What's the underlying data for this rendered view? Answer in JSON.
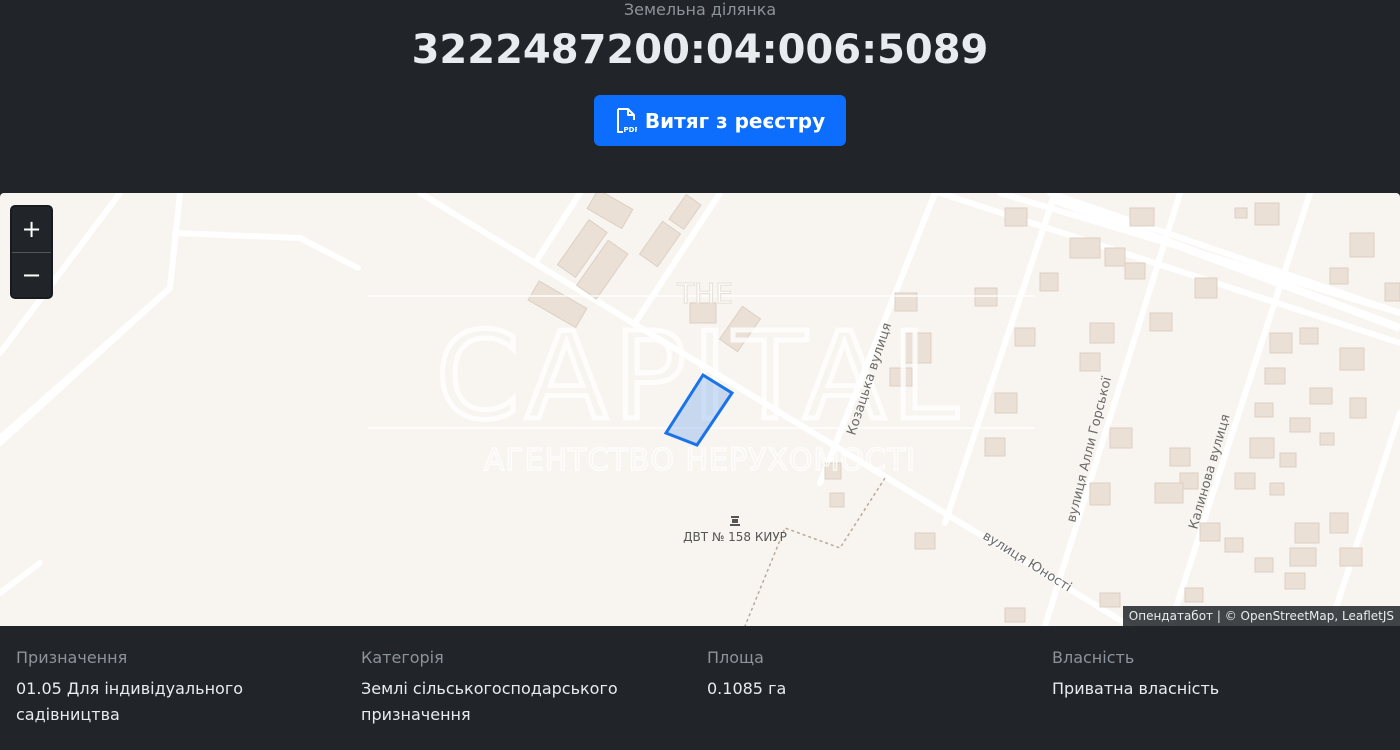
{
  "header": {
    "subtitle": "Земельна ділянка",
    "cadastral_number": "3222487200:04:006:5089",
    "pdf_button_label": "Витяг з реєстру"
  },
  "map": {
    "zoom_in": "+",
    "zoom_out": "−",
    "attribution": "Опендатабот | © OpenStreetMap, LeafletJS",
    "labels": {
      "street_kozatska": "Козацька вулиця",
      "street_yunosti": "вулиця Юності",
      "street_ally_horskoi": "вулиця Алли Горської",
      "street_kalynova": "Калинова вулиця",
      "poi_dvt": "ДВТ № 158 КИУР"
    },
    "watermark": {
      "top": "THE",
      "main": "CAPITAL",
      "bottom": "АГЕНТСТВО НЕРУХОМОСТІ"
    },
    "parcel_color": "#1a73e8"
  },
  "info": {
    "purpose_label": "Призначення",
    "purpose_value": "01.05 Для індивідуального садівництва",
    "category_label": "Категорія",
    "category_value": "Землі сільськогосподарського призначення",
    "area_label": "Площа",
    "area_value": "0.1085 га",
    "ownership_label": "Власність",
    "ownership_value": "Приватна власність"
  }
}
